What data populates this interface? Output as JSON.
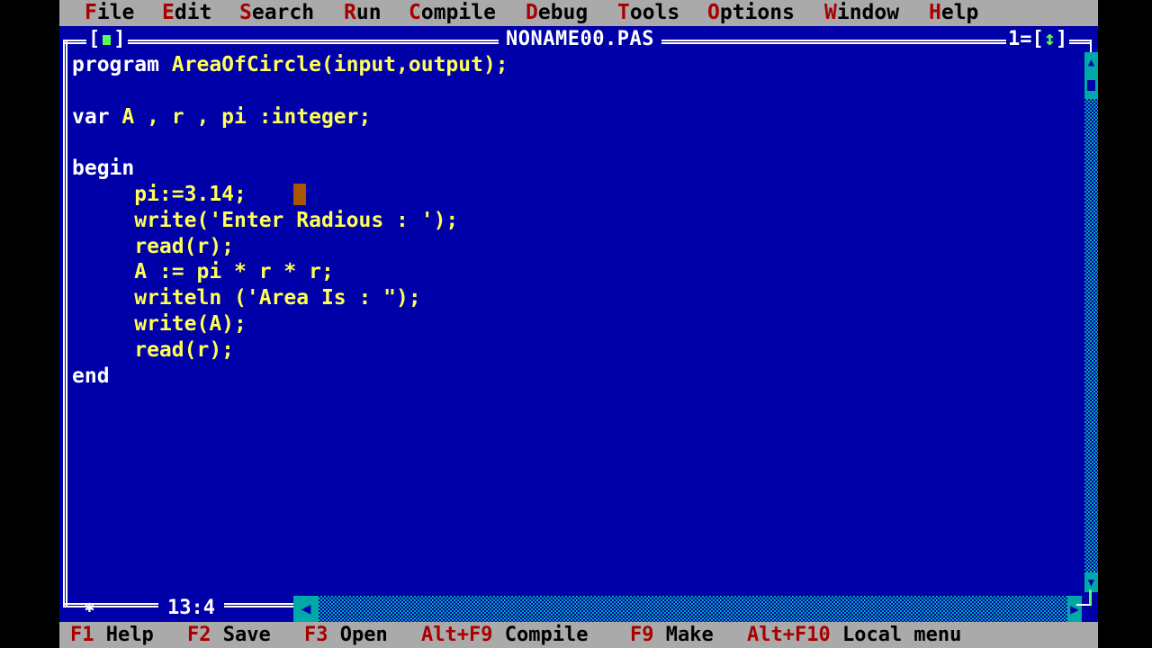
{
  "menubar": {
    "items": [
      {
        "hot": "F",
        "rest": "ile"
      },
      {
        "hot": "E",
        "rest": "dit"
      },
      {
        "hot": "S",
        "rest": "earch"
      },
      {
        "hot": "R",
        "rest": "un"
      },
      {
        "hot": "C",
        "rest": "ompile"
      },
      {
        "hot": "D",
        "rest": "ebug"
      },
      {
        "hot": "T",
        "rest": "ools"
      },
      {
        "hot": "O",
        "rest": "ptions"
      },
      {
        "hot": "W",
        "rest": "indow"
      },
      {
        "hot": "H",
        "rest": "elp"
      }
    ]
  },
  "window": {
    "title": "NONAME00.PAS",
    "number": "1",
    "close_left": "[",
    "close_right": "]",
    "zoom_left": "=[",
    "zoom_glyph": "↕",
    "zoom_right": "]",
    "cursor_position": "13:4"
  },
  "editor": {
    "lines": [
      {
        "kw": "program ",
        "text": "AreaOfCircle(input,output);"
      },
      {
        "kw": "",
        "text": ""
      },
      {
        "kw": "var ",
        "text": "A , r , pi :integer;"
      },
      {
        "kw": "",
        "text": ""
      },
      {
        "kw": "begin",
        "text": ""
      },
      {
        "kw": "",
        "text": "     pi:=3.14;"
      },
      {
        "kw": "",
        "text": "     write('Enter Radious : ');"
      },
      {
        "kw": "",
        "text": "     read(r);"
      },
      {
        "kw": "",
        "text": "     A := pi * r * r;"
      },
      {
        "kw": "",
        "text": "     writeln ('Area Is : \");"
      },
      {
        "kw": "",
        "text": "     write(A);"
      },
      {
        "kw": "",
        "text": "     read(r);"
      },
      {
        "kw": "end",
        "text": ""
      }
    ]
  },
  "statusbar": {
    "items": [
      {
        "key": "F1",
        "label": " Help"
      },
      {
        "key": "F2",
        "label": " Save"
      },
      {
        "key": "F3",
        "label": " Open"
      },
      {
        "key": "Alt+F9",
        "label": " Compile"
      },
      {
        "key": "F9",
        "label": " Make"
      },
      {
        "key": "Alt+F10",
        "label": " Local menu"
      }
    ]
  },
  "colors": {
    "editor_bg": "#0000a8",
    "menu_bg": "#aaaaaa",
    "hotkey": "#a80000",
    "identifier": "#ffff55",
    "keyword": "#ffffff",
    "scrollbar": "#00a8a8",
    "cursor": "#aa5500"
  }
}
